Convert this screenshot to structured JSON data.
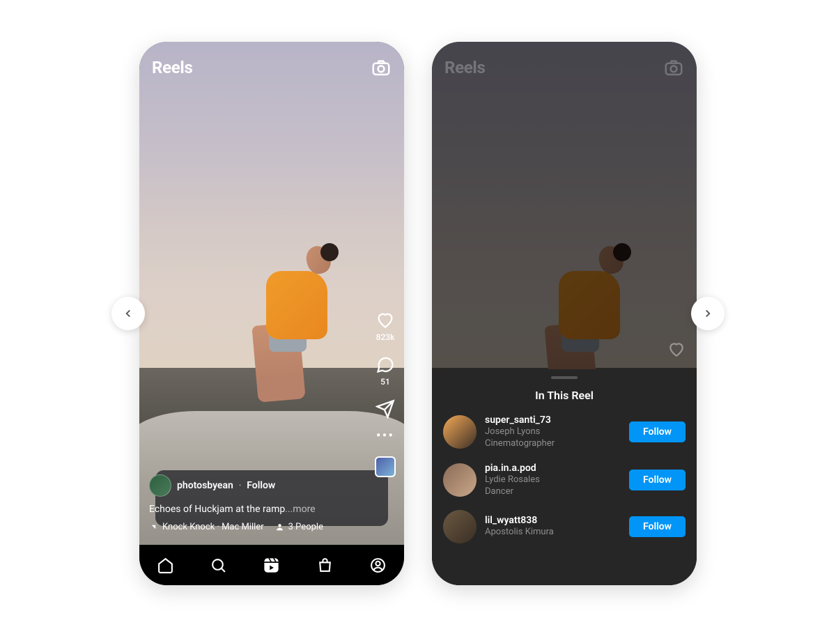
{
  "header": {
    "title": "Reels"
  },
  "reel": {
    "username": "photosbyean",
    "follow_label": "Follow",
    "caption_text": "Echoes of Huckjam at the ramp",
    "caption_more": "...more",
    "audio": "Knock Knock · Mac Miller",
    "tagged": "3 People",
    "likes": "823k",
    "comments": "51"
  },
  "sheet": {
    "title": "In This Reel",
    "people": [
      {
        "username": "super_santi_73",
        "name": "Joseph Lyons",
        "role": "Cinematographer",
        "follow": "Follow"
      },
      {
        "username": "pia.in.a.pod",
        "name": "Lydie Rosales",
        "role": "Dancer",
        "follow": "Follow"
      },
      {
        "username": "lil_wyatt838",
        "name": "Apostolis Kimura",
        "role": "",
        "follow": "Follow"
      }
    ]
  }
}
